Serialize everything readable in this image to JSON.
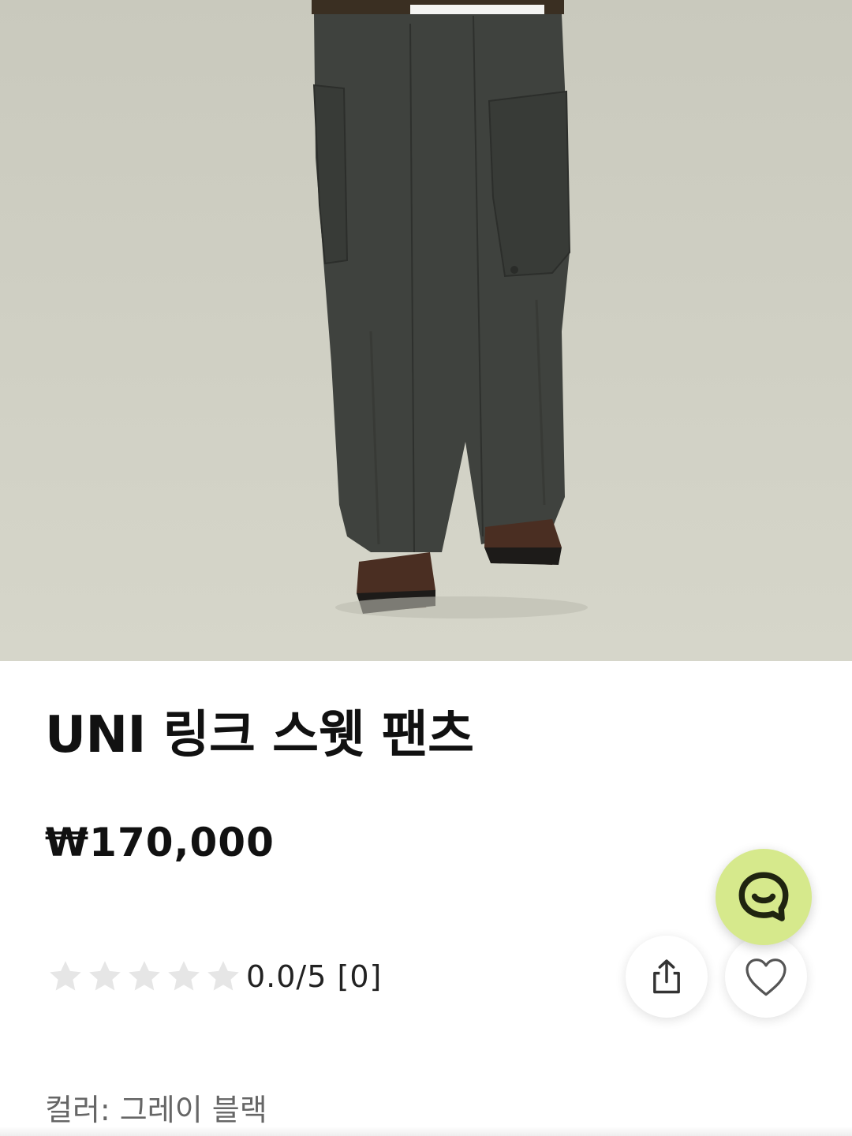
{
  "product": {
    "title": "UNI 링크 스웻 팬츠",
    "price": "₩170,000",
    "rating_text": "0.0/5 [0]",
    "rating_value": 0,
    "rating_max": 5,
    "color_line": "컬러: 그레이 블랙"
  },
  "icons": {
    "share": "share-icon",
    "like": "heart-icon",
    "chat": "chat-icon",
    "star": "star-icon"
  },
  "colors": {
    "chat_button": "#d6e98c",
    "star_empty": "#e6e6e6",
    "pants": "#3f423e",
    "background_photo": "#cfcfc3"
  }
}
